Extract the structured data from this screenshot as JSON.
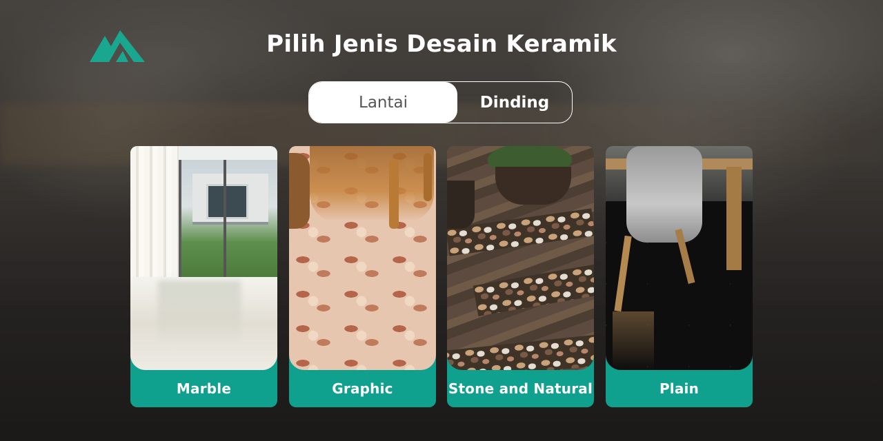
{
  "header": {
    "logo_icon": "mountain-logo-icon",
    "title": "Pilih Jenis Desain Keramik"
  },
  "toggle": {
    "options": [
      {
        "label": "Lantai",
        "selected": true
      },
      {
        "label": "Dinding",
        "selected": false
      }
    ]
  },
  "categories": [
    {
      "label": "Marble"
    },
    {
      "label": "Graphic"
    },
    {
      "label": "Stone and Natural"
    },
    {
      "label": "Plain"
    }
  ],
  "colors": {
    "accent": "#0fa08e",
    "toggle_active_bg": "#ffffff",
    "title_text": "#ffffff"
  }
}
